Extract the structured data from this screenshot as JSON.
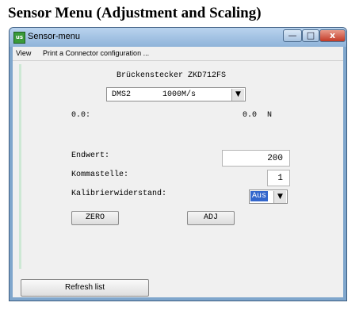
{
  "doc_title": "Sensor Menu (Adjustment and Scaling)",
  "window": {
    "icon_label": "us",
    "title": "Sensor-menu",
    "controls": {
      "minimize": "—",
      "maximize": "□",
      "close": "x"
    }
  },
  "menu": {
    "view": "View",
    "print": "Print a Connector configuration ..."
  },
  "panel": {
    "connector_title": "Brückenstecker ZKD712FS",
    "sensor_select": {
      "type": "DMS2",
      "rate": "1000M/s",
      "arrow": "▼"
    },
    "reading_left": "0.0:",
    "reading_right": "0.0",
    "reading_unit": "N",
    "endwert": {
      "label": "Endwert:",
      "value": "200"
    },
    "kommastelle": {
      "label": "Kommastelle:",
      "value": "1"
    },
    "kalibrier": {
      "label": "Kalibrierwiderstand:",
      "value": "Aus",
      "arrow": "▼"
    },
    "zero_button": "ZERO",
    "adj_button": "ADJ"
  },
  "footer": {
    "refresh_button": "Refresh list"
  }
}
